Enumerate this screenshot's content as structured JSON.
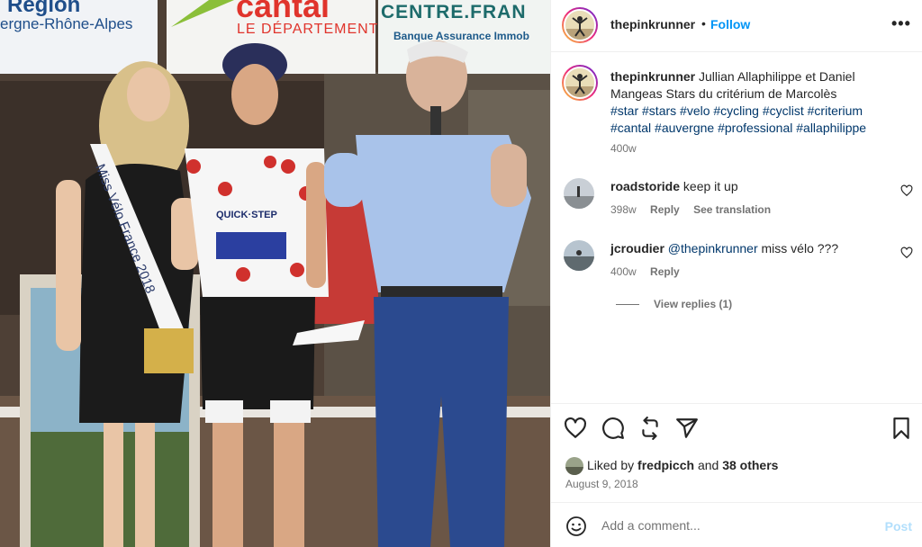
{
  "photo": {
    "banner": {
      "region": "Région",
      "region_sub": "ergne-Rhône-Alpes",
      "cantal": "cantal",
      "cantal_sub": "LE DÉPARTEMENT",
      "centre": "CENTRE.FRAN",
      "banque": "Banque Assurance Immob"
    },
    "sash_text": "Miss Vélo France 2018",
    "jersey_text": "QUICK·STEP"
  },
  "header": {
    "username": "thepinkrunner",
    "separator": "•",
    "follow_label": "Follow",
    "more_icon": "more-horizontal-icon"
  },
  "caption": {
    "username": "thepinkrunner",
    "text": "Jullian Allaphilippe et Daniel Mangeas Stars du critérium de Marcolès",
    "hashtags": "#star #stars #velo #cycling #cyclist #criterium #cantal #auvergne #professional #allaphilippe",
    "time": "400w"
  },
  "comments": [
    {
      "username": "roadstoride",
      "mention": "",
      "text": "keep it up",
      "time": "398w",
      "reply_label": "Reply",
      "translate_label": "See translation"
    },
    {
      "username": "jcroudier",
      "mention": "@thepinkrunner",
      "text": "miss vélo ???",
      "time": "400w",
      "reply_label": "Reply",
      "translate_label": ""
    }
  ],
  "view_replies_label": "View replies (1)",
  "actions": {
    "icons": [
      "heart-icon",
      "comment-icon",
      "repost-icon",
      "share-icon",
      "bookmark-icon"
    ]
  },
  "likes": {
    "prefix": "Liked by",
    "user": "fredpicch",
    "joiner": "and",
    "others": "38 others"
  },
  "post_date": "August 9, 2018",
  "add_comment": {
    "placeholder": "Add a comment...",
    "post_label": "Post"
  },
  "colors": {
    "link": "#00376b",
    "follow": "#0095f6",
    "post_disabled": "#b2dffc",
    "muted": "#737373"
  }
}
